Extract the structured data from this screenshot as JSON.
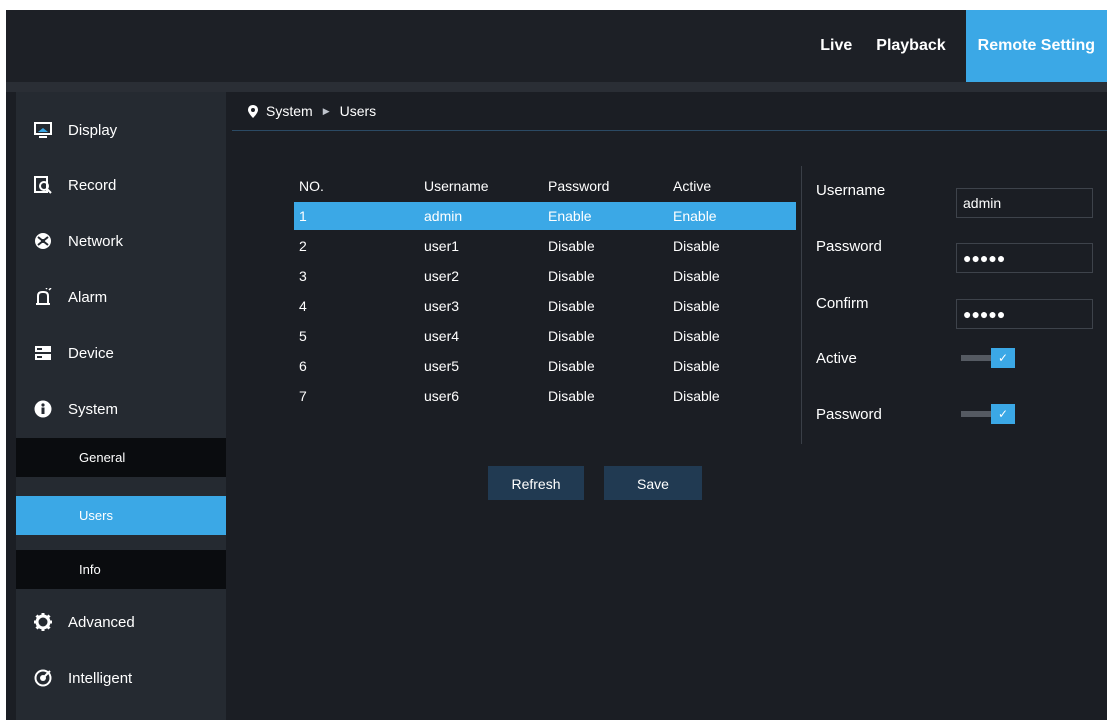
{
  "topnav": {
    "live": "Live",
    "playback": "Playback",
    "remote_setting": "Remote Setting"
  },
  "sidebar": {
    "items": [
      {
        "label": "Display",
        "icon": "display-icon"
      },
      {
        "label": "Record",
        "icon": "record-icon"
      },
      {
        "label": "Network",
        "icon": "network-icon"
      },
      {
        "label": "Alarm",
        "icon": "alarm-icon"
      },
      {
        "label": "Device",
        "icon": "device-icon"
      },
      {
        "label": "System",
        "icon": "info-icon"
      },
      {
        "label": "Advanced",
        "icon": "gear-icon"
      },
      {
        "label": "Intelligent",
        "icon": "intelligent-icon"
      }
    ],
    "subitems": [
      "General",
      "Users",
      "Info"
    ],
    "active_subitem": "Users"
  },
  "breadcrumb": {
    "section": "System",
    "page": "Users"
  },
  "table": {
    "headers": [
      "NO.",
      "Username",
      "Password",
      "Active"
    ],
    "rows": [
      [
        "1",
        "admin",
        "Enable",
        "Enable"
      ],
      [
        "2",
        "user1",
        "Disable",
        "Disable"
      ],
      [
        "3",
        "user2",
        "Disable",
        "Disable"
      ],
      [
        "4",
        "user3",
        "Disable",
        "Disable"
      ],
      [
        "5",
        "user4",
        "Disable",
        "Disable"
      ],
      [
        "6",
        "user5",
        "Disable",
        "Disable"
      ],
      [
        "7",
        "user6",
        "Disable",
        "Disable"
      ]
    ],
    "selected_row": 1
  },
  "form": {
    "username_label": "Username",
    "username_value": "admin",
    "password_label": "Password",
    "password_value": "●●●●●",
    "confirm_label": "Confirm",
    "confirm_value": "●●●●●",
    "active_label": "Active",
    "active_checked": true,
    "password_toggle_label": "Password",
    "password_toggle_checked": true
  },
  "buttons": {
    "refresh": "Refresh",
    "save": "Save"
  },
  "colors": {
    "accent": "#3ba8e6",
    "background": "#1b1e24",
    "sidebar": "#252a31",
    "button": "#213a52"
  }
}
